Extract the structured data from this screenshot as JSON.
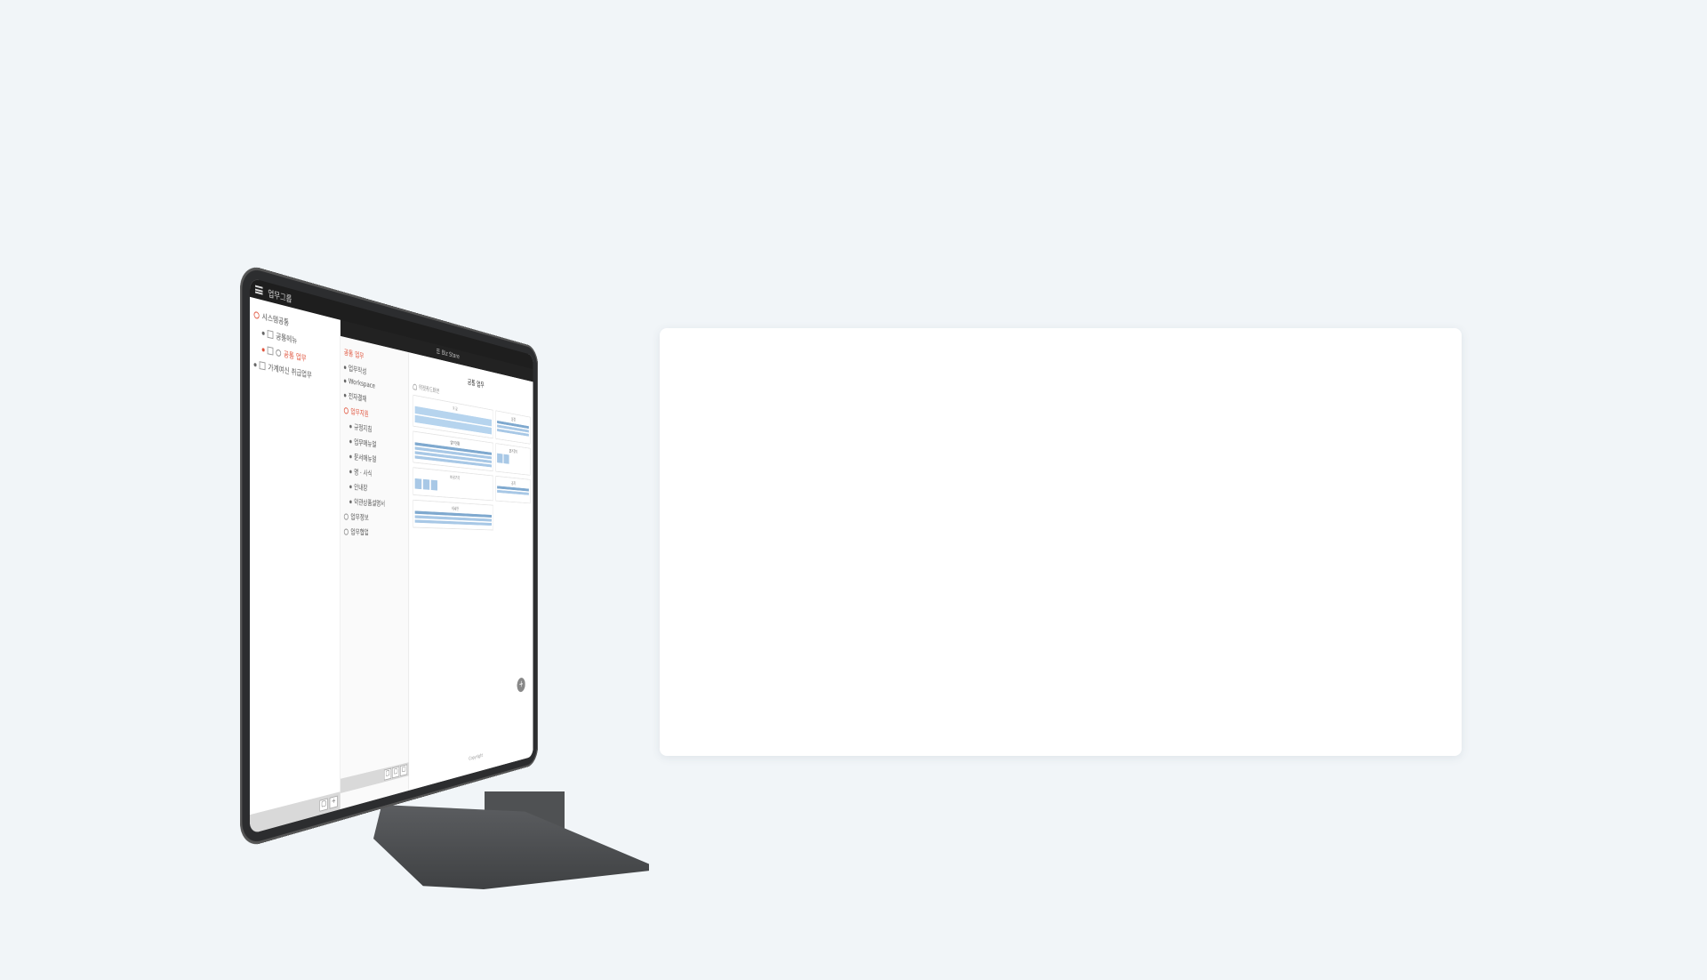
{
  "app": {
    "menu_title": "업무그룹",
    "store_title": "Biz Store"
  },
  "left_tree": {
    "items": [
      {
        "label": "시스템공통",
        "type": "circle",
        "active": false,
        "indent": 0
      },
      {
        "label": "공통메뉴",
        "type": "dot",
        "active": false,
        "indent": 1
      },
      {
        "label": "공통 업무",
        "type": "dot",
        "active": true,
        "indent": 1
      },
      {
        "label": "가계여신 취급업무",
        "type": "dot",
        "active": false,
        "indent": 0
      }
    ]
  },
  "mid_tree": {
    "header": "공통 업무",
    "items": [
      {
        "label": "업무작성",
        "indent": 0
      },
      {
        "label": "Workspace",
        "indent": 0
      },
      {
        "label": "전자결재",
        "indent": 0
      },
      {
        "label": "업무지원",
        "indent": 0
      },
      {
        "label": "규정지침",
        "indent": 1
      },
      {
        "label": "업무매뉴얼",
        "indent": 1
      },
      {
        "label": "문서매뉴얼",
        "indent": 1
      },
      {
        "label": "명 · 사식",
        "indent": 1
      },
      {
        "label": "안내장",
        "indent": 1
      },
      {
        "label": "약관상품설명서",
        "indent": 1
      },
      {
        "label": "업무정보",
        "indent": 0
      },
      {
        "label": "업무협업",
        "indent": 0
      }
    ]
  },
  "main": {
    "title": "공통 업무",
    "subtitle": "위젯카드화면",
    "widgets": [
      "메모",
      "일정",
      "업무현황",
      "즐겨찾기",
      "바로가기",
      "공지",
      "결재",
      "게시판"
    ],
    "add_label": "+",
    "copyright": "Copyright"
  },
  "footer_buttons": {
    "left": [
      "▢",
      "+"
    ],
    "mid": [
      "▢",
      "▢",
      "▢"
    ]
  },
  "colors": {
    "background": "#f1f5f8",
    "card": "#ffffff",
    "bezel": "#2c2d2f",
    "accent": "#e0533c",
    "widget_bar": "#a8c8e6"
  }
}
